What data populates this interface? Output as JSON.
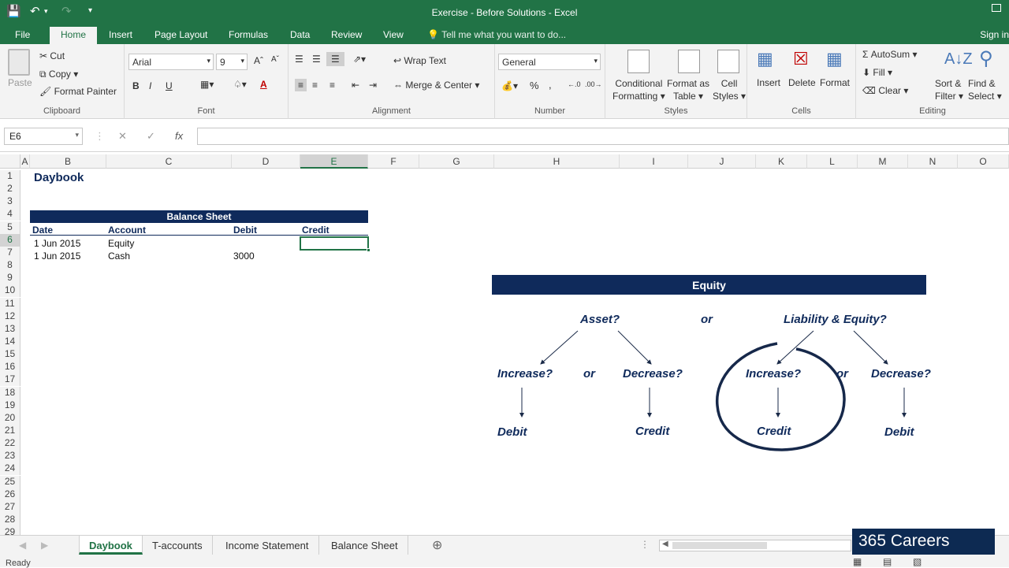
{
  "window": {
    "title": "Exercise - Before Solutions - Excel",
    "signin": "Sign in"
  },
  "ribbon_tabs": [
    "File",
    "Home",
    "Insert",
    "Page Layout",
    "Formulas",
    "Data",
    "Review",
    "View"
  ],
  "tell_me": "Tell me what you want to do...",
  "clipboard": {
    "paste": "Paste",
    "cut": "Cut",
    "copy": "Copy",
    "format_painter": "Format Painter",
    "label": "Clipboard"
  },
  "font": {
    "name": "Arial",
    "size": "9",
    "label": "Font",
    "bold": "B",
    "italic": "I",
    "underline": "U"
  },
  "alignment": {
    "wrap": "Wrap Text",
    "merge": "Merge & Center",
    "label": "Alignment"
  },
  "number": {
    "format": "General",
    "label": "Number",
    "percent": "%",
    "comma": ","
  },
  "styles": {
    "conditional": [
      "Conditional",
      "Formatting"
    ],
    "format_table": [
      "Format as",
      "Table"
    ],
    "cell_styles": [
      "Cell",
      "Styles"
    ],
    "label": "Styles"
  },
  "cells": {
    "insert": "Insert",
    "delete": "Delete",
    "format": "Format",
    "label": "Cells"
  },
  "editing": {
    "autosum": "AutoSum",
    "fill": "Fill",
    "clear": "Clear",
    "sort": [
      "Sort &",
      "Filter"
    ],
    "find": [
      "Find &",
      "Select"
    ],
    "label": "Editing"
  },
  "formula_bar": {
    "name_box": "E6",
    "fx": "fx",
    "value": ""
  },
  "columns": [
    "A",
    "B",
    "C",
    "D",
    "E",
    "F",
    "G",
    "H",
    "I",
    "J",
    "K",
    "L",
    "M",
    "N",
    "O"
  ],
  "rows": [
    "1",
    "2",
    "3",
    "4",
    "5",
    "6",
    "7",
    "8",
    "9",
    "10",
    "11",
    "12",
    "13",
    "14",
    "15",
    "16",
    "17",
    "18",
    "19",
    "20",
    "21",
    "22",
    "23",
    "24",
    "25",
    "26",
    "27",
    "28",
    "29"
  ],
  "sheet": {
    "title": "Daybook",
    "banner": "Balance Sheet",
    "headers": [
      "Date",
      "Account",
      "Debit",
      "Credit"
    ],
    "rows": [
      {
        "date": "1 Jun 2015",
        "account": "Equity",
        "debit": "",
        "credit": ""
      },
      {
        "date": "1 Jun 2015",
        "account": "Cash",
        "debit": "3000",
        "credit": ""
      }
    ]
  },
  "diagram": {
    "banner": "Equity",
    "asset": "Asset?",
    "or_top": "or",
    "liab": "Liability & Equity?",
    "inc1": "Increase?",
    "or1": "or",
    "dec1": "Decrease?",
    "inc2": "Increase?",
    "or2": "or",
    "dec2": "Decrease?",
    "debit1": "Debit",
    "credit1": "Credit",
    "credit2": "Credit",
    "debit2": "Debit"
  },
  "sheet_tabs": [
    "Daybook",
    "T-accounts",
    "Income Statement",
    "Balance Sheet"
  ],
  "status": "Ready",
  "watermark": "365 Careers",
  "colors": {
    "excel_green": "#217346",
    "navy": "#0f2a5b"
  }
}
